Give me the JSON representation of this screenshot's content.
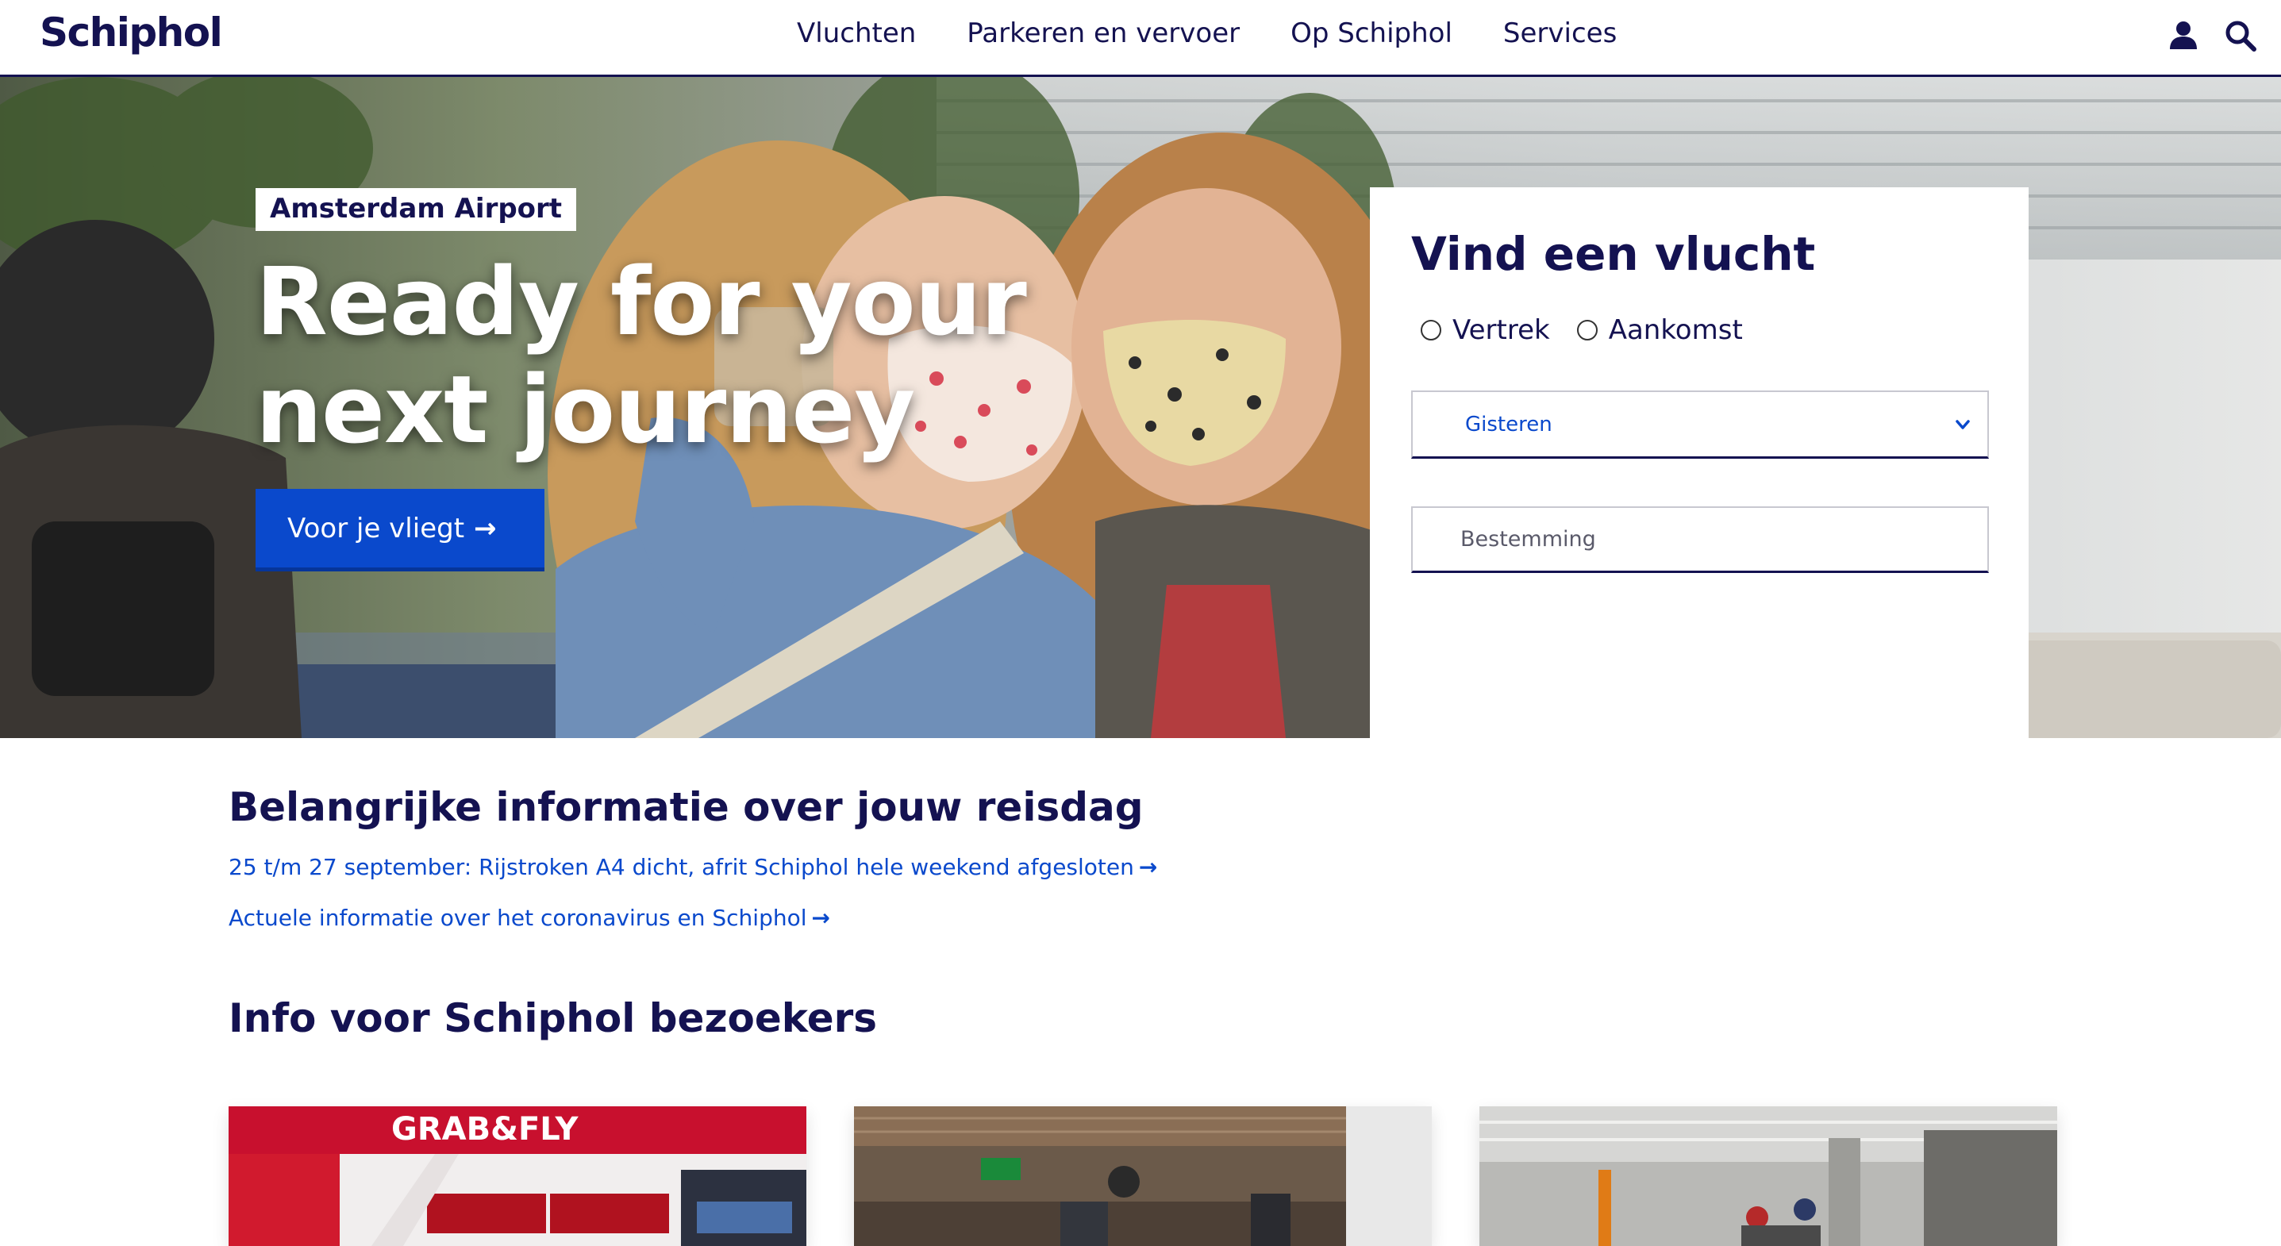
{
  "header": {
    "logo": "Schiphol",
    "nav": [
      "Vluchten",
      "Parkeren en vervoer",
      "Op Schiphol",
      "Services"
    ],
    "icons": [
      "user-icon",
      "search-icon"
    ]
  },
  "hero": {
    "tag": "Amsterdam Airport",
    "title": "Ready for your next journey",
    "button_label": "Voor je vliegt"
  },
  "flight_search": {
    "title": "Vind een vlucht",
    "radio_departure": "Vertrek",
    "radio_arrival": "Aankomst",
    "date_select_value": "Gisteren",
    "destination_placeholder": "Bestemming"
  },
  "info": {
    "title": "Belangrijke informatie over jouw reisdag",
    "links": [
      "25 t/m 27 september: Rijstroken A4 dicht, afrit Schiphol hele weekend afgesloten",
      "Actuele informatie over het coronavirus en Schiphol"
    ]
  },
  "visitors": {
    "title": "Info voor Schiphol bezoekers",
    "card1_sign": "GRAB&FLY"
  },
  "colors": {
    "navy": "#141251",
    "blue": "#0a49cc",
    "white": "#ffffff"
  }
}
